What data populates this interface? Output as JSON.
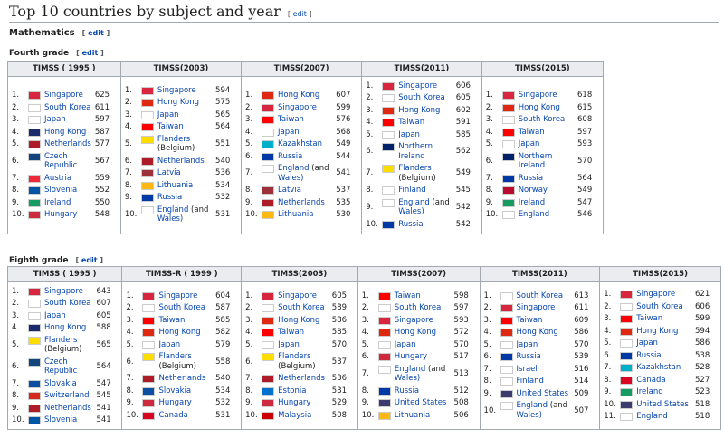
{
  "page_title": "Top 10 countries by subject and year",
  "edit_label": "edit",
  "section": "Mathematics",
  "fourth": {
    "heading": "Fourth grade",
    "columns": [
      {
        "header": "TIMSS ( 1995 )",
        "rows": [
          {
            "n": "1.",
            "name": "Singapore",
            "score": "625",
            "flag": "#d7263d"
          },
          {
            "n": "2.",
            "name": "South Korea",
            "score": "611",
            "flag": "#ffffff"
          },
          {
            "n": "3.",
            "name": "Japan",
            "score": "597",
            "flag": "#ffffff"
          },
          {
            "n": "4.",
            "name": "Hong Kong",
            "score": "587",
            "flag": "#1a2a6c"
          },
          {
            "n": "5.",
            "name": "Netherlands",
            "score": "577",
            "flag": "#ae1c28"
          },
          {
            "n": "6.",
            "name": "Czech",
            "name2": "Republic",
            "score": "567",
            "flag": "#11457e"
          },
          {
            "n": "7.",
            "name": "Austria",
            "score": "559",
            "flag": "#ed2939"
          },
          {
            "n": "8.",
            "name": "Slovenia",
            "score": "552",
            "flag": "#0055a4"
          },
          {
            "n": "9.",
            "name": "Ireland",
            "score": "550",
            "flag": "#169b62"
          },
          {
            "n": "10.",
            "name": "Hungary",
            "score": "548",
            "flag": "#cd2a3e"
          }
        ]
      },
      {
        "header": "TIMSS(2003)",
        "rows": [
          {
            "n": "1.",
            "name": "Singapore",
            "score": "594",
            "flag": "#d7263d"
          },
          {
            "n": "2.",
            "name": "Hong Kong",
            "score": "575",
            "flag": "#de2910"
          },
          {
            "n": "3.",
            "name": "Japan",
            "score": "565",
            "flag": "#ffffff"
          },
          {
            "n": "4.",
            "name": "Taiwan",
            "score": "564",
            "flag": "#fe0000"
          },
          {
            "n": "5.",
            "name": "Flanders",
            "name2": "(Belgium)",
            "plain2": true,
            "score": "551",
            "flag": "#fddc00"
          },
          {
            "n": "6.",
            "name": "Netherlands",
            "score": "540",
            "flag": "#ae1c28"
          },
          {
            "n": "7.",
            "name": "Latvia",
            "score": "536",
            "flag": "#9e3039"
          },
          {
            "n": "8.",
            "name": "Lithuania",
            "score": "534",
            "flag": "#fdb913"
          },
          {
            "n": "9.",
            "name": "Russia",
            "score": "532",
            "flag": "#0039a6"
          },
          {
            "n": "10.",
            "name": "England",
            "extra": " (and",
            "name2": "Wales)",
            "score": "531",
            "flag": "#ffffff"
          }
        ]
      },
      {
        "header": "TIMSS(2007)",
        "rows": [
          {
            "n": "1.",
            "name": "Hong Kong",
            "score": "607",
            "flag": "#de2910"
          },
          {
            "n": "2.",
            "name": "Singapore",
            "score": "599",
            "flag": "#d7263d"
          },
          {
            "n": "3.",
            "name": "Taiwan",
            "score": "576",
            "flag": "#fe0000"
          },
          {
            "n": "4.",
            "name": "Japan",
            "score": "568",
            "flag": "#ffffff"
          },
          {
            "n": "5.",
            "name": "Kazakhstan",
            "score": "549",
            "flag": "#00afca"
          },
          {
            "n": "6.",
            "name": "Russia",
            "score": "544",
            "flag": "#0039a6"
          },
          {
            "n": "7.",
            "name": "England",
            "extra": " (and",
            "name2": "Wales)",
            "score": "541",
            "flag": "#ffffff"
          },
          {
            "n": "8.",
            "name": "Latvia",
            "score": "537",
            "flag": "#9e3039"
          },
          {
            "n": "9.",
            "name": "Netherlands",
            "score": "535",
            "flag": "#ae1c28"
          },
          {
            "n": "10.",
            "name": "Lithuania",
            "score": "530",
            "flag": "#fdb913"
          }
        ]
      },
      {
        "header": "TIMSS(2011)",
        "rows": [
          {
            "n": "1.",
            "name": "Singapore",
            "score": "606",
            "flag": "#d7263d"
          },
          {
            "n": "2.",
            "name": "South Korea",
            "score": "605",
            "flag": "#ffffff"
          },
          {
            "n": "3.",
            "name": "Hong Kong",
            "score": "602",
            "flag": "#de2910"
          },
          {
            "n": "4.",
            "name": "Taiwan",
            "score": "591",
            "flag": "#fe0000"
          },
          {
            "n": "5.",
            "name": "Japan",
            "score": "585",
            "flag": "#ffffff"
          },
          {
            "n": "6.",
            "name": "Northern",
            "name2": "Ireland",
            "score": "562",
            "flag": "#012169"
          },
          {
            "n": "7.",
            "name": "Flanders",
            "name2": "(Belgium)",
            "plain2": true,
            "score": "549",
            "flag": "#fddc00"
          },
          {
            "n": "8.",
            "name": "Finland",
            "score": "545",
            "flag": "#ffffff"
          },
          {
            "n": "9.",
            "name": "England",
            "extra": " (and",
            "name2": "Wales)",
            "score": "542",
            "flag": "#ffffff"
          },
          {
            "n": "10.",
            "name": "Russia",
            "score": "542",
            "flag": "#0039a6"
          }
        ]
      },
      {
        "header": "TIMSS(2015)",
        "rows": [
          {
            "n": "1.",
            "name": "Singapore",
            "score": "618",
            "flag": "#d7263d"
          },
          {
            "n": "2.",
            "name": "Hong Kong",
            "score": "615",
            "flag": "#de2910"
          },
          {
            "n": "3.",
            "name": "South Korea",
            "score": "608",
            "flag": "#ffffff"
          },
          {
            "n": "4.",
            "name": "Taiwan",
            "score": "597",
            "flag": "#fe0000"
          },
          {
            "n": "5.",
            "name": "Japan",
            "score": "593",
            "flag": "#ffffff"
          },
          {
            "n": "6.",
            "name": "Northern",
            "name2": "Ireland",
            "score": "570",
            "flag": "#012169"
          },
          {
            "n": "7.",
            "name": "Russia",
            "score": "564",
            "flag": "#0039a6"
          },
          {
            "n": "8.",
            "name": "Norway",
            "score": "549",
            "flag": "#ba0c2f"
          },
          {
            "n": "9.",
            "name": "Ireland",
            "score": "547",
            "flag": "#169b62"
          },
          {
            "n": "10.",
            "name": "England",
            "score": "546",
            "flag": "#ffffff"
          }
        ]
      }
    ]
  },
  "eighth": {
    "heading": "Eighth grade",
    "columns": [
      {
        "header": "TIMSS ( 1995 )",
        "rows": [
          {
            "n": "1.",
            "name": "Singapore",
            "score": "643",
            "flag": "#d7263d"
          },
          {
            "n": "2.",
            "name": "South Korea",
            "score": "607",
            "flag": "#ffffff"
          },
          {
            "n": "3.",
            "name": "Japan",
            "score": "605",
            "flag": "#ffffff"
          },
          {
            "n": "4.",
            "name": "Hong Kong",
            "score": "588",
            "flag": "#1a2a6c"
          },
          {
            "n": "5.",
            "name": "Flanders",
            "name2": "(Belgium)",
            "plain2": true,
            "score": "565",
            "flag": "#fddc00"
          },
          {
            "n": "6.",
            "name": "Czech",
            "name2": "Republic",
            "score": "564",
            "flag": "#11457e"
          },
          {
            "n": "7.",
            "name": "Slovakia",
            "score": "547",
            "flag": "#0b4ea2"
          },
          {
            "n": "8.",
            "name": "Switzerland",
            "score": "545",
            "flag": "#d52b1e"
          },
          {
            "n": "9.",
            "name": "Netherlands",
            "score": "541",
            "flag": "#ae1c28"
          },
          {
            "n": "10.",
            "name": "Slovenia",
            "score": "541",
            "flag": "#0055a4"
          }
        ]
      },
      {
        "header": "TIMSS-R ( 1999 )",
        "rows": [
          {
            "n": "1.",
            "name": "Singapore",
            "score": "604",
            "flag": "#d7263d"
          },
          {
            "n": "2.",
            "name": "South Korea",
            "score": "587",
            "flag": "#ffffff"
          },
          {
            "n": "3.",
            "name": "Taiwan",
            "score": "585",
            "flag": "#fe0000"
          },
          {
            "n": "4.",
            "name": "Hong Kong",
            "score": "582",
            "flag": "#de2910"
          },
          {
            "n": "5.",
            "name": "Japan",
            "score": "579",
            "flag": "#ffffff"
          },
          {
            "n": "6.",
            "name": "Flanders",
            "name2": "(Belgium)",
            "plain2": true,
            "score": "558",
            "flag": "#fddc00"
          },
          {
            "n": "7.",
            "name": "Netherlands",
            "score": "540",
            "flag": "#ae1c28"
          },
          {
            "n": "8.",
            "name": "Slovakia",
            "score": "534",
            "flag": "#0b4ea2"
          },
          {
            "n": "9.",
            "name": "Hungary",
            "score": "532",
            "flag": "#cd2a3e"
          },
          {
            "n": "10.",
            "name": "Canada",
            "score": "531",
            "flag": "#d80621"
          }
        ]
      },
      {
        "header": "TIMSS(2003)",
        "rows": [
          {
            "n": "1.",
            "name": "Singapore",
            "score": "605",
            "flag": "#d7263d"
          },
          {
            "n": "2.",
            "name": "South Korea",
            "score": "589",
            "flag": "#ffffff"
          },
          {
            "n": "3.",
            "name": "Hong Kong",
            "score": "586",
            "flag": "#de2910"
          },
          {
            "n": "4.",
            "name": "Taiwan",
            "score": "585",
            "flag": "#fe0000"
          },
          {
            "n": "5.",
            "name": "Japan",
            "score": "570",
            "flag": "#ffffff"
          },
          {
            "n": "6.",
            "name": "Flanders",
            "name2": "(Belgium)",
            "plain2": true,
            "score": "537",
            "flag": "#fddc00"
          },
          {
            "n": "7.",
            "name": "Netherlands",
            "score": "536",
            "flag": "#ae1c28"
          },
          {
            "n": "8.",
            "name": "Estonia",
            "score": "531",
            "flag": "#0072ce"
          },
          {
            "n": "9.",
            "name": "Hungary",
            "score": "529",
            "flag": "#cd2a3e"
          },
          {
            "n": "10.",
            "name": "Malaysia",
            "score": "508",
            "flag": "#cc0001"
          }
        ]
      },
      {
        "header": "TIMSS(2007)",
        "rows": [
          {
            "n": "1.",
            "name": "Taiwan",
            "score": "598",
            "flag": "#fe0000"
          },
          {
            "n": "2.",
            "name": "South Korea",
            "score": "597",
            "flag": "#ffffff"
          },
          {
            "n": "3.",
            "name": "Singapore",
            "score": "593",
            "flag": "#d7263d"
          },
          {
            "n": "4.",
            "name": "Hong Kong",
            "score": "572",
            "flag": "#de2910"
          },
          {
            "n": "5.",
            "name": "Japan",
            "score": "570",
            "flag": "#ffffff"
          },
          {
            "n": "6.",
            "name": "Hungary",
            "score": "517",
            "flag": "#cd2a3e"
          },
          {
            "n": "7.",
            "name": "England",
            "extra": " (and",
            "name2": "Wales)",
            "score": "513",
            "flag": "#ffffff"
          },
          {
            "n": "8.",
            "name": "Russia",
            "score": "512",
            "flag": "#0039a6"
          },
          {
            "n": "9.",
            "name": "United States",
            "score": "508",
            "flag": "#3c3b6e"
          },
          {
            "n": "10.",
            "name": "Lithuania",
            "score": "506",
            "flag": "#fdb913"
          }
        ]
      },
      {
        "header": "TIMSS(2011)",
        "rows": [
          {
            "n": "1.",
            "name": "South Korea",
            "score": "613",
            "flag": "#ffffff"
          },
          {
            "n": "2.",
            "name": "Singapore",
            "score": "611",
            "flag": "#d7263d"
          },
          {
            "n": "3.",
            "name": "Taiwan",
            "score": "609",
            "flag": "#fe0000"
          },
          {
            "n": "4.",
            "name": "Hong Kong",
            "score": "586",
            "flag": "#de2910"
          },
          {
            "n": "5.",
            "name": "Japan",
            "score": "570",
            "flag": "#ffffff"
          },
          {
            "n": "6.",
            "name": "Russia",
            "score": "539",
            "flag": "#0039a6"
          },
          {
            "n": "7.",
            "name": "Israel",
            "score": "516",
            "flag": "#ffffff"
          },
          {
            "n": "8.",
            "name": "Finland",
            "score": "514",
            "flag": "#ffffff"
          },
          {
            "n": "9.",
            "name": "United States",
            "score": "509",
            "flag": "#3c3b6e"
          },
          {
            "n": "10.",
            "name": "England",
            "extra": " (and",
            "name2": "Wales)",
            "score": "507",
            "flag": "#ffffff"
          }
        ]
      },
      {
        "header": "TIMSS(2015)",
        "rows": [
          {
            "n": "1.",
            "name": "Singapore",
            "score": "621",
            "flag": "#d7263d"
          },
          {
            "n": "2.",
            "name": "South Korea",
            "score": "606",
            "flag": "#ffffff"
          },
          {
            "n": "3.",
            "name": "Taiwan",
            "score": "599",
            "flag": "#fe0000"
          },
          {
            "n": "4.",
            "name": "Hong Kong",
            "score": "594",
            "flag": "#de2910"
          },
          {
            "n": "5.",
            "name": "Japan",
            "score": "586",
            "flag": "#ffffff"
          },
          {
            "n": "6.",
            "name": "Russia",
            "score": "538",
            "flag": "#0039a6"
          },
          {
            "n": "7.",
            "name": "Kazakhstan",
            "score": "528",
            "flag": "#00afca"
          },
          {
            "n": "8.",
            "name": "Canada",
            "score": "527",
            "flag": "#d80621"
          },
          {
            "n": "9.",
            "name": "Ireland",
            "score": "523",
            "flag": "#169b62"
          },
          {
            "n": "10.",
            "name": "United States",
            "score": "518",
            "flag": "#3c3b6e"
          },
          {
            "n": "11.",
            "name": "England",
            "score": "518",
            "flag": "#ffffff"
          }
        ]
      }
    ]
  }
}
